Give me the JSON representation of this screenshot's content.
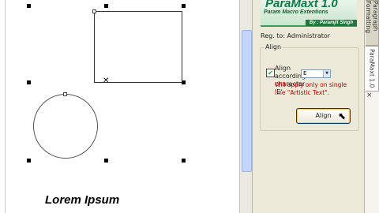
{
  "canvas": {
    "text_object": "Lorem Ipsum"
  },
  "docker": {
    "logo": {
      "title": "ParaMaxt 1.0",
      "subtitle": "Param Macro Extentions",
      "byline": "By : Paramjit Singh"
    },
    "registration": "Reg. to: Administrator",
    "align_group": {
      "title": "Align",
      "checkbox_label": "Align according character 'E'",
      "checkbox_checked": true,
      "character_value": "E",
      "warning": "Will apply only on single line \"Artistic Text\".",
      "button_label": "Align"
    }
  },
  "tabs": {
    "inactive_label": "Paragraph Formatting",
    "active_label": "ParaMaxt 1.0",
    "close_glyph": "×"
  },
  "colors": {
    "brand_green": "#0f7a48",
    "warning_red": "#c00000",
    "docker_bg": "#ece9d8"
  }
}
